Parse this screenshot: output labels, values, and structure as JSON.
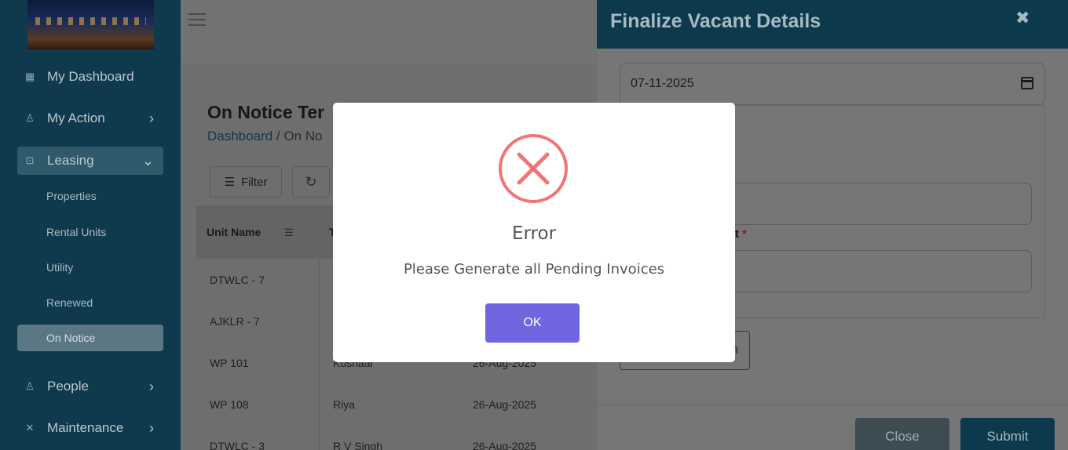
{
  "sidebar": {
    "items": [
      {
        "label": "My Dashboard",
        "icon": "dashboard-icon"
      },
      {
        "label": "My Action",
        "icon": "user-icon"
      },
      {
        "label": "Leasing",
        "icon": "lock-icon"
      },
      {
        "label": "People",
        "icon": "people-icon"
      },
      {
        "label": "Maintenance",
        "icon": "tools-icon"
      }
    ],
    "leasing_sub": [
      "Properties",
      "Rental Units",
      "Utility",
      "Renewed",
      "On Notice"
    ]
  },
  "main": {
    "title": "On Notice Ter",
    "breadcrumb": {
      "home": "Dashboard",
      "separator": "/",
      "current": "On No"
    },
    "filter_label": "Filter",
    "table": {
      "headers": [
        "Unit Name",
        "T"
      ],
      "rows": [
        [
          "DTWLC - 7",
          "",
          ""
        ],
        [
          "AJKLR - 7",
          "",
          ""
        ],
        [
          "WP 101",
          "Kushaal",
          "26-Aug-2025"
        ],
        [
          "WP 108",
          "Riya",
          "26-Aug-2025"
        ],
        [
          "DTWLC - 3",
          "R V Singh",
          "26-Aug-2025"
        ]
      ]
    }
  },
  "drawer": {
    "title": "Finalize Vacant Details",
    "date_value": "07-11-2025",
    "field_label_suffix": "t",
    "required_mark": "*",
    "attach_label": "n",
    "close_label": "Close",
    "submit_label": "Submit"
  },
  "modal": {
    "title": "Error",
    "message": "Please Generate all Pending Invoices",
    "ok_label": "OK",
    "error_color": "#f27474",
    "button_color": "#7066e0"
  }
}
